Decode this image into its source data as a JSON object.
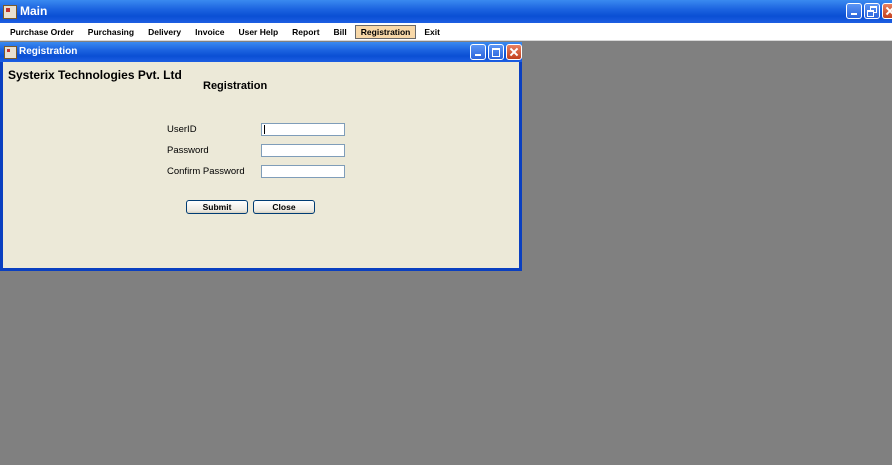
{
  "main_window": {
    "title": "Main"
  },
  "menu": {
    "items": [
      "Purchase Order",
      "Purchasing",
      "Delivery",
      "Invoice",
      "User Help",
      "Report",
      "Bill",
      "Registration",
      "Exit"
    ],
    "active": "Registration"
  },
  "registration_window": {
    "title": "Registration",
    "company_name": "Systerix Technologies Pvt. Ltd",
    "heading": "Registration",
    "fields": {
      "userid": {
        "label": "UserID",
        "value": ""
      },
      "password": {
        "label": "Password",
        "value": ""
      },
      "confirm_password": {
        "label": "Confirm Password",
        "value": ""
      }
    },
    "buttons": {
      "submit": "Submit",
      "close": "Close"
    }
  },
  "colors": {
    "titlebar": "#0a4fd4",
    "form_background": "#ece9d8",
    "mdi_background": "#808080",
    "active_menu": "#f8d8a8"
  }
}
